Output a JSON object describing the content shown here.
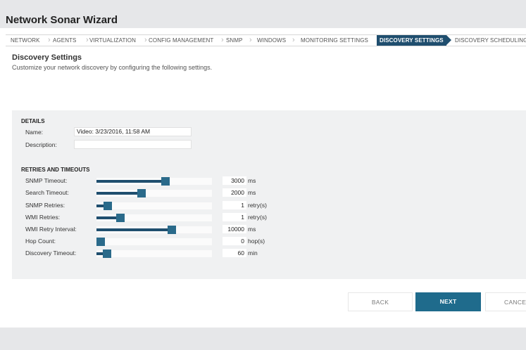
{
  "wizard": {
    "title": "Network Sonar Wizard"
  },
  "steps": [
    {
      "label": "NETWORK"
    },
    {
      "label": "AGENTS"
    },
    {
      "label": "VIRTUALIZATION"
    },
    {
      "label": "CONFIG MANAGEMENT"
    },
    {
      "label": "SNMP"
    },
    {
      "label": "WINDOWS"
    },
    {
      "label": "MONITORING SETTINGS"
    },
    {
      "label": "DISCOVERY SETTINGS",
      "active": true
    },
    {
      "label": "DISCOVERY SCHEDULING"
    }
  ],
  "page": {
    "title": "Discovery Settings",
    "subtitle": "Customize your network discovery by configuring the following settings."
  },
  "details": {
    "heading": "DETAILS",
    "name_label": "Name:",
    "name_value": "Video: 3/23/2016, 11:58 AM",
    "description_label": "Description:",
    "description_value": ""
  },
  "retries": {
    "heading": "RETRIES AND TIMEOUTS",
    "items": [
      {
        "label": "SNMP Timeout:",
        "value": "3000",
        "unit": "ms",
        "level": 0.6
      },
      {
        "label": "Search Timeout:",
        "value": "2000",
        "unit": "ms",
        "level": 0.39
      },
      {
        "label": "SNMP Retries:",
        "value": "1",
        "unit": "retry(s)",
        "level": 0.1
      },
      {
        "label": "WMI Retries:",
        "value": "1",
        "unit": "retry(s)",
        "level": 0.21
      },
      {
        "label": "WMI Retry Interval:",
        "value": "10000",
        "unit": "ms",
        "level": 0.65
      },
      {
        "label": "Hop Count:",
        "value": "0",
        "unit": "hop(s)",
        "level": 0.0
      },
      {
        "label": "Discovery Timeout:",
        "value": "60",
        "unit": "min",
        "level": 0.09
      }
    ]
  },
  "buttons": {
    "back": "BACK",
    "next": "NEXT",
    "cancel": "CANCEL"
  },
  "colors": {
    "accent": "#1f4e6e",
    "primary_button": "#1f6b8c"
  }
}
